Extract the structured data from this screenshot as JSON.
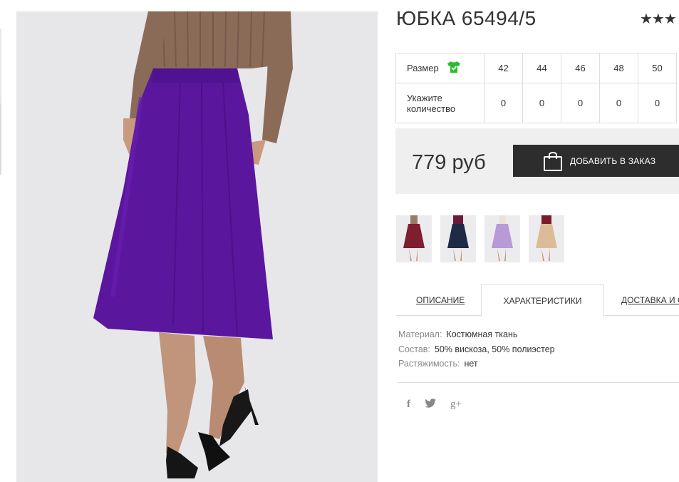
{
  "product": {
    "title": "ЮБКА 65494/5",
    "rating": "★★★"
  },
  "sizes": {
    "size_label": "Размер",
    "size_icon": "tshirt-check-icon",
    "qty_label_line1": "Укажите",
    "qty_label_line2": "количество",
    "columns": [
      "42",
      "44",
      "46",
      "48",
      "50"
    ],
    "quantities": [
      "0",
      "0",
      "0",
      "0",
      "0"
    ]
  },
  "purchase": {
    "price": "779 руб",
    "add_button": "ДОБАВИТЬ В ЗАКАЗ",
    "add_icon": "shopping-bag-icon"
  },
  "variants": [
    {
      "name": "burgundy",
      "color": "#7e1e2e"
    },
    {
      "name": "navy",
      "color": "#1f2a45"
    },
    {
      "name": "lavender",
      "color": "#b89ad6"
    },
    {
      "name": "beige",
      "color": "#dcbc98"
    }
  ],
  "tabs": {
    "description": "ОПИСАНИЕ",
    "characteristics": "ХАРАКТЕРИСТИКИ",
    "delivery": "ДОСТАВКА И О"
  },
  "specs": [
    {
      "key": "Материал:",
      "value": "Костюмная ткань"
    },
    {
      "key": "Состав:",
      "value": "50% вискоза, 50% полиэстер"
    },
    {
      "key": "Растяжимость:",
      "value": "нет"
    }
  ],
  "social": {
    "facebook": "f",
    "twitter_icon": "twitter-icon",
    "googleplus": "g+"
  },
  "colors": {
    "skirt": "#5b169e",
    "sweater": "#8a6b58",
    "button_bg": "#2d2d2d",
    "icon_green": "#2dbb2d"
  }
}
